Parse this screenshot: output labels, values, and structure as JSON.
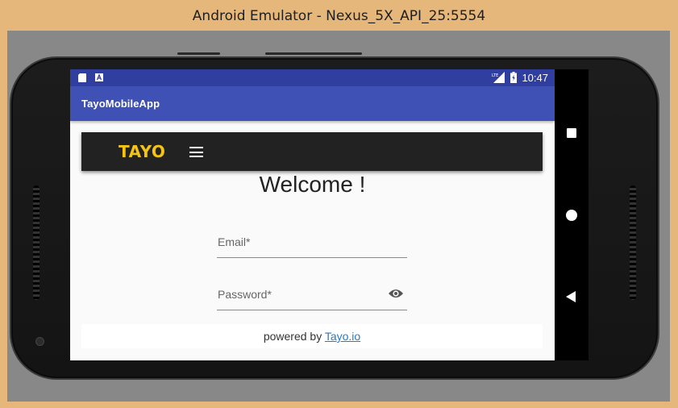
{
  "window": {
    "title": "Android Emulator - Nexus_5X_API_25:5554"
  },
  "status_bar": {
    "time": "10:47",
    "left_icons": [
      "sd-card-icon",
      "a-notification-icon"
    ],
    "right_icons": [
      "lte-signal-icon",
      "battery-icon"
    ]
  },
  "app_bar": {
    "title": "TayoMobileApp"
  },
  "header": {
    "logo_text": "TAYO",
    "menu_icon": "hamburger-menu-icon"
  },
  "main": {
    "heading": "Welcome !",
    "email": {
      "label": "Email*",
      "value": ""
    },
    "password": {
      "label": "Password*",
      "value": "",
      "toggle_icon": "eye-icon"
    }
  },
  "footer": {
    "prefix": "powered by ",
    "link_text": "Tayo.io"
  },
  "nav_bar": {
    "buttons": [
      "recents-icon",
      "home-icon",
      "back-icon"
    ]
  },
  "colors": {
    "status_bar": "#303f9f",
    "app_bar": "#3f51b5",
    "logo": "#f4c414",
    "header_bg": "#222222",
    "link": "#2a7ac4"
  }
}
